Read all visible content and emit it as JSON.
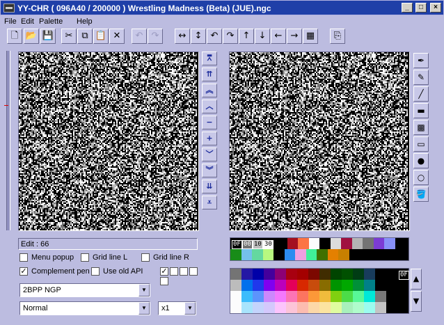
{
  "window": {
    "title": "YY-CHR ( 096A40 / 200000 )  Wrestling Madness (Beta) (JUE).ngc",
    "minimize": "_",
    "maximize": "□",
    "close": "×"
  },
  "menu": [
    "File",
    "Edit",
    "Palette",
    "Help"
  ],
  "toolbar": {
    "new_icon": "🗋",
    "open_icon": "📂",
    "save_icon": "💾",
    "cut_icon": "✂",
    "copy_icon": "⧉",
    "paste_icon": "📋",
    "delete_icon": "✕",
    "undo_icon": "↶",
    "redo_icon": "↷",
    "flip_h_icon": "↔",
    "flip_v_icon": "↕",
    "rot_left_icon": "↶",
    "rot_right_icon": "↷",
    "shift_up_icon": "↑",
    "shift_down_icon": "↓",
    "shift_left_icon": "←",
    "shift_right_icon": "→",
    "replace_color_icon": "▦",
    "property_icon": "⎘"
  },
  "scroll_buttons": [
    "⩞",
    "⇈",
    "︽",
    "︿",
    "−",
    "+",
    "﹀",
    "︾",
    "⇊",
    "⩡"
  ],
  "tools": [
    "✒",
    "✎",
    "╱",
    "▬",
    "▩",
    "▭",
    "●",
    "○",
    "🪣"
  ],
  "status": {
    "edit": "Edit : 66"
  },
  "options": {
    "menu_popup": {
      "label": "Menu popup",
      "checked": false
    },
    "grid_line_l": {
      "label": "Grid line L",
      "checked": false
    },
    "grid_line_r": {
      "label": "Grid line R",
      "checked": false
    },
    "complement_pen": {
      "label": "Complement pen",
      "checked": true
    },
    "use_old_api": {
      "label": "Use old API",
      "checked": false
    },
    "mini_checks": [
      true,
      false,
      false,
      false,
      false
    ]
  },
  "format_select": {
    "value": "2BPP NGP"
  },
  "mode_select": {
    "value": "Normal"
  },
  "zoom_select": {
    "value": "x1"
  },
  "palette": {
    "indices": [
      "0F",
      "00",
      "10",
      "30"
    ],
    "selected_label": "0F",
    "active_colors": [
      "#000000",
      "#747474",
      "#bcbcbc",
      "#fcfcfc"
    ],
    "row1": [
      "#000000",
      "#a41020",
      "#fc7444",
      "#fcfcfc",
      "#000000",
      "#dcdcdc",
      "#a01040",
      "#b4b4b4",
      "#747474",
      "#7c3cd4",
      "#8890f8"
    ],
    "row2": [
      "#188c18",
      "#74c0ec",
      "#64d8a0",
      "#b8f880",
      "#000000",
      "#2c8cf0",
      "#f0a0e0",
      "#40f098",
      "#407000",
      "#e48000",
      "#c88000"
    ],
    "grid": [
      [
        "#747474",
        "#2418a4",
        "#0000a8",
        "#44009c",
        "#8c0074",
        "#a80010",
        "#a40000",
        "#7c0800",
        "#402c00",
        "#004400",
        "#005000",
        "#003c14",
        "#183c5c",
        "#000000",
        "#000000",
        "#000000"
      ],
      [
        "#bcbcbc",
        "#0070ec",
        "#2038ec",
        "#8000f0",
        "#bc00bc",
        "#e40058",
        "#d82800",
        "#c84c0c",
        "#886c00",
        "#009400",
        "#00a800",
        "#009038",
        "#008088",
        "#000000",
        "#000000",
        "#000000"
      ],
      [
        "#fcfcfc",
        "#3cbcfc",
        "#5c94fc",
        "#cc88fc",
        "#f478fc",
        "#fc74b4",
        "#fc7460",
        "#fc9838",
        "#f0bc3c",
        "#80d010",
        "#4cdc48",
        "#58f898",
        "#00e8d8",
        "#787878",
        "#000000",
        "#000000"
      ],
      [
        "#fcfcfc",
        "#a8e4fc",
        "#c4d4fc",
        "#d4c8fc",
        "#fcc4fc",
        "#fcc4d8",
        "#fcbcb0",
        "#fcd8a8",
        "#fce4a0",
        "#e0fca0",
        "#a8f0bc",
        "#b0fccc",
        "#9cfcf0",
        "#c4c4c4",
        "#000000",
        "#000000"
      ]
    ]
  }
}
